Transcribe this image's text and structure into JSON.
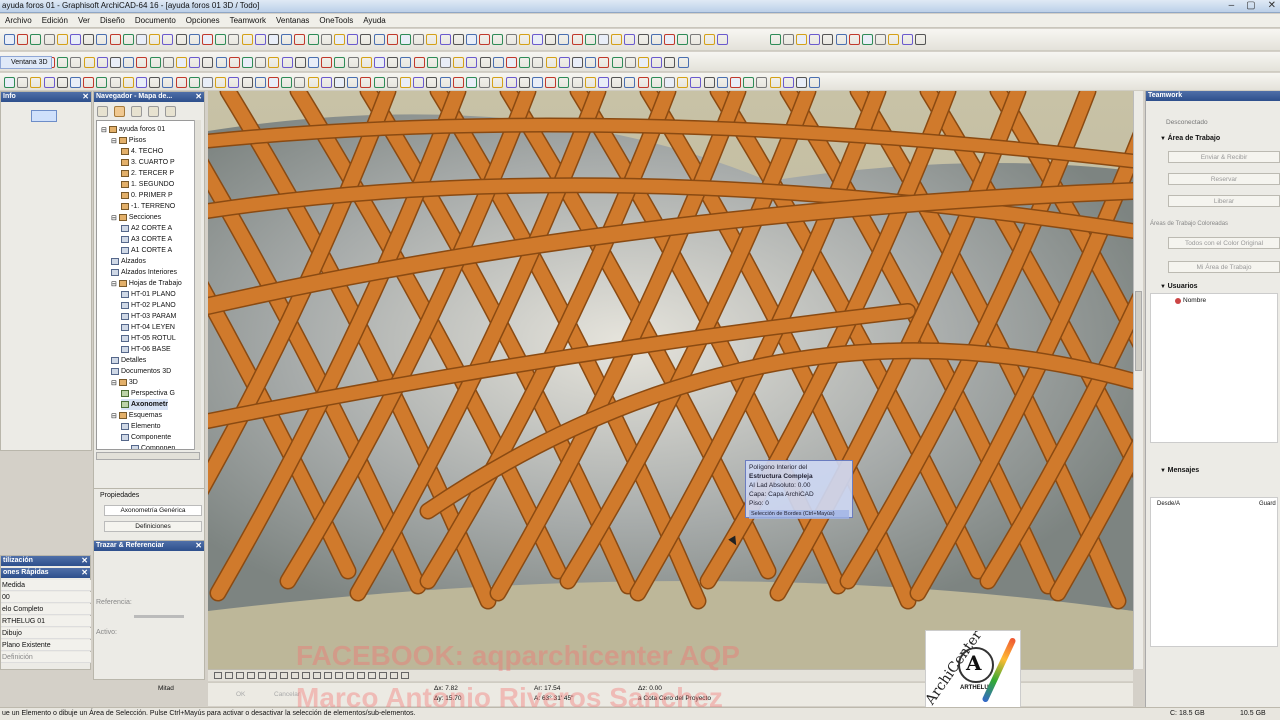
{
  "window": {
    "title": "ayuda foros 01 - Graphisoft ArchiCAD-64 16 - [ayuda foros 01 3D / Todo]",
    "controls": [
      "–",
      "▢",
      "✕"
    ]
  },
  "menu": [
    "Archivo",
    "Edición",
    "Ver",
    "Diseño",
    "Documento",
    "Opciones",
    "Teamwork",
    "Ventanas",
    "OneTools",
    "Ayuda"
  ],
  "left_panel": {
    "info_title": "Info",
    "ventana_label": "Ventana 3D",
    "sel_title": "tilización",
    "quick_title": "ones Rápidas",
    "quick_rows": [
      "Medida",
      "00",
      "elo Completo",
      "RTHELUG 01",
      "Dibujo",
      "Plano Existente",
      "Definición"
    ]
  },
  "navigator": {
    "title": "Navegador - Mapa de...",
    "items": [
      {
        "label": "ayuda foros 01",
        "level": 0,
        "type": "folder"
      },
      {
        "label": "Pisos",
        "level": 1,
        "type": "folder"
      },
      {
        "label": "4. TECHO",
        "level": 2,
        "type": "floor"
      },
      {
        "label": "3. CUARTO P",
        "level": 2,
        "type": "floor"
      },
      {
        "label": "2. TERCER P",
        "level": 2,
        "type": "floor"
      },
      {
        "label": "1. SEGUNDO",
        "level": 2,
        "type": "floor"
      },
      {
        "label": "0. PRIMER P",
        "level": 2,
        "type": "floor"
      },
      {
        "label": "-1. TERRENO",
        "level": 2,
        "type": "floor"
      },
      {
        "label": "Secciones",
        "level": 1,
        "type": "folder"
      },
      {
        "label": "A2 CORTE A",
        "level": 2,
        "type": "sec"
      },
      {
        "label": "A3 CORTE A",
        "level": 2,
        "type": "sec"
      },
      {
        "label": "A1 CORTE A",
        "level": 2,
        "type": "sec"
      },
      {
        "label": "Alzados",
        "level": 1,
        "type": "sec"
      },
      {
        "label": "Alzados Interiores",
        "level": 1,
        "type": "sec"
      },
      {
        "label": "Hojas de Trabajo",
        "level": 1,
        "type": "folder"
      },
      {
        "label": "HT-01 PLANO",
        "level": 2,
        "type": "sec"
      },
      {
        "label": "HT-02 PLANO",
        "level": 2,
        "type": "sec"
      },
      {
        "label": "HT-03 PARAM",
        "level": 2,
        "type": "sec"
      },
      {
        "label": "HT-04 LEYEN",
        "level": 2,
        "type": "sec"
      },
      {
        "label": "HT-05 ROTUL",
        "level": 2,
        "type": "sec"
      },
      {
        "label": "HT-06 BASE",
        "level": 2,
        "type": "sec"
      },
      {
        "label": "Detalles",
        "level": 1,
        "type": "sec"
      },
      {
        "label": "Documentos 3D",
        "level": 1,
        "type": "sec"
      },
      {
        "label": "3D",
        "level": 1,
        "type": "folder"
      },
      {
        "label": "Perspectiva G",
        "level": 2,
        "type": "cam"
      },
      {
        "label": "Axonometr",
        "level": 2,
        "type": "cam",
        "selected": true
      },
      {
        "label": "Esquemas",
        "level": 1,
        "type": "folder"
      },
      {
        "label": "Elemento",
        "level": 2,
        "type": "sec"
      },
      {
        "label": "Componente",
        "level": 2,
        "type": "sec"
      },
      {
        "label": "Componen",
        "level": 3,
        "type": "sec"
      }
    ],
    "props_title": "Propiedades",
    "props_value": "Axonometría Genérica",
    "props_button": "Definiciones"
  },
  "trace": {
    "title": "Trazar & Referenciar",
    "ref_label": "Referencia:",
    "active_label": "Activo:"
  },
  "tooltip": {
    "title": "Polígono Interior del",
    "name": "Estructura Compleja",
    "elev": "Al Lad Absoluto: 0.00",
    "layer": "Capa: Capa ArchiCAD",
    "floor": "Piso: 0",
    "hint": "Selección de Bordes (Ctrl+Mayús)"
  },
  "watermark": {
    "line1": "FACEBOOK: aqparchicenter AQP",
    "line2": "Marco Antonio Riveros Sanchez"
  },
  "logo": {
    "text": "ArchiCenter",
    "brand": "ARTHELUG"
  },
  "coords": {
    "mode": "Mitad",
    "ok": "OK",
    "cancel": "Cancelar",
    "dx": "Δx: 7.82",
    "dy": "Δy: 15.70",
    "ar": "Ar: 17.54",
    "aa": "A: 63° 31' 45\"",
    "dz": "Δz: 0.00",
    "ref": "a Cota Cero del Proyecto"
  },
  "teamwork": {
    "title": "Teamwork",
    "status": "Desconectado",
    "area_title": "Área de Trabajo",
    "btn_send": "Enviar & Recibir",
    "btn_reserve": "Reservar",
    "btn_release": "Liberar",
    "colored_label": "Áreas de Trabajo Coloreadas",
    "btn_color": "Todos con el Color Original",
    "btn_myarea": "Mi Área de Trabajo",
    "users_title": "Usuarios",
    "user_name": "Nombre",
    "messages_title": "Mensajes",
    "msg_from": "Desde/A",
    "msg_save": "Guard"
  },
  "status": {
    "text": "ue un Elemento o dibuje un Área de Selección. Pulse Ctrl+Mayús para activar o desactivar la selección de elementos/sub-elementos.",
    "disk1": "C: 18.5 GB",
    "disk2": "10.5 GB"
  }
}
